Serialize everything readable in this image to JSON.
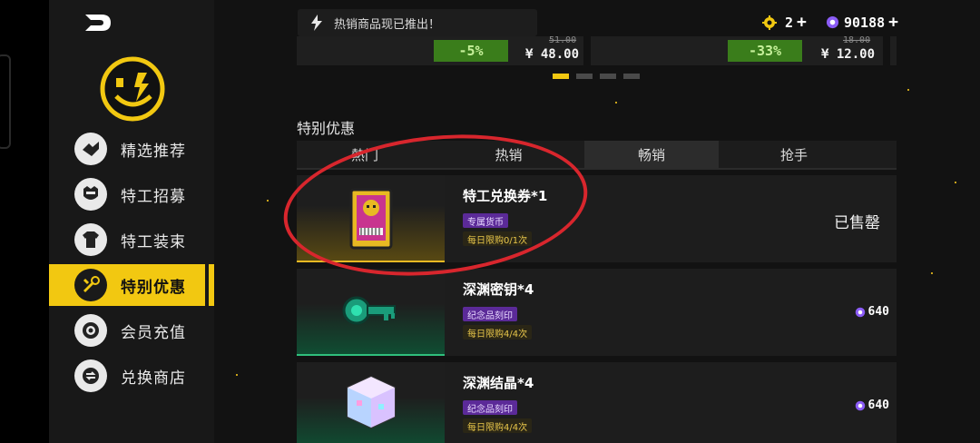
{
  "sidebar": {
    "items": [
      {
        "label": "精选推荐",
        "icon": "handshake-icon",
        "active": false
      },
      {
        "label": "特工招募",
        "icon": "agent-recruit-icon",
        "active": false
      },
      {
        "label": "特工装束",
        "icon": "outfit-icon",
        "active": false
      },
      {
        "label": "特别优惠",
        "icon": "wrench-icon",
        "active": true
      },
      {
        "label": "会员充值",
        "icon": "coin-icon",
        "active": false
      },
      {
        "label": "兑换商店",
        "icon": "exchange-icon",
        "active": false
      }
    ]
  },
  "header": {
    "notice": "热销商品现已推出！",
    "currency_gold": "2",
    "currency_purple": "90188"
  },
  "banner": {
    "deals": [
      {
        "discount": "-5%",
        "old_price": "51.00",
        "price": "¥ 48.00"
      },
      {
        "discount": "-33%",
        "old_price": "18.00",
        "price": "¥ 12.00"
      }
    ],
    "page_dots": 4,
    "active_dot": 0
  },
  "section": {
    "title": "特别优惠",
    "tabs": [
      "熱门",
      "热销",
      "畅销",
      "抢手"
    ],
    "active_tab": 2
  },
  "products": [
    {
      "title": "特工兑换券*1",
      "tag": "专属货币",
      "limit": "每日限购0/1次",
      "sold_out": "已售罄",
      "price": ""
    },
    {
      "title": "深渊密钥*4",
      "tag": "纪念品刻印",
      "limit": "每日限购4/4次",
      "sold_out": "",
      "price": "640"
    },
    {
      "title": "深渊结晶*4",
      "tag": "纪念品刻印",
      "limit": "每日限购4/4次",
      "sold_out": "",
      "price": "640"
    }
  ],
  "colors": {
    "accent": "#f2c811",
    "discount": "#3a7d1b",
    "tag_purple": "#5b2a98",
    "annotation": "#d8262d"
  }
}
